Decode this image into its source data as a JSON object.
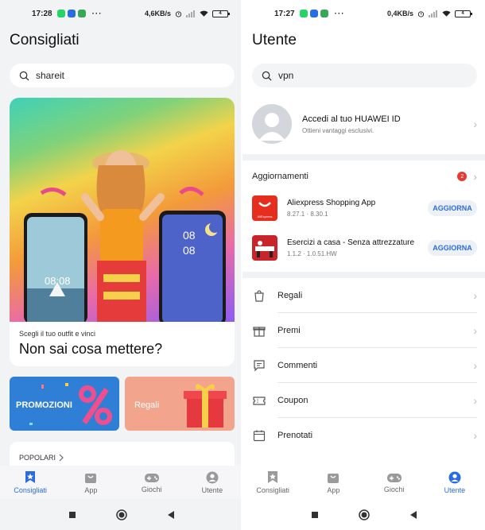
{
  "left": {
    "status": {
      "time": "17:28",
      "speed": "4,6KB/s",
      "battery": "4"
    },
    "title": "Consigliati",
    "search": {
      "value": "shareit"
    },
    "banner": {
      "subtitle": "Scegli il tuo outfit e vinci",
      "title": "Non sai cosa mettere?",
      "phone_time": "08:08",
      "phone2_time_top": "08",
      "phone2_time_bottom": "08"
    },
    "tiles": {
      "promo": "PROMOZIONI",
      "gifts": "Regali"
    },
    "popular": "POPOLARI",
    "nav": [
      {
        "label": "Consigliati",
        "icon": "star-bookmark-icon",
        "active": true
      },
      {
        "label": "App",
        "icon": "bag-icon",
        "active": false
      },
      {
        "label": "Giochi",
        "icon": "gamepad-icon",
        "active": false
      },
      {
        "label": "Utente",
        "icon": "user-icon",
        "active": false
      }
    ]
  },
  "right": {
    "status": {
      "time": "17:27",
      "speed": "0,4KB/s",
      "battery": "4"
    },
    "title": "Utente",
    "search": {
      "value": "vpn"
    },
    "profile": {
      "name": "Accedi al tuo HUAWEI ID",
      "subtitle": "Ottieni vantaggi esclusivi."
    },
    "updates": {
      "label": "Aggiornamenti",
      "count": "2"
    },
    "apps": [
      {
        "name": "Aliexpress Shopping App",
        "version": "8.27.1 · 8.30.1",
        "button": "AGGIORNA",
        "icon_text": "AliExpress"
      },
      {
        "name": "Esercizi a casa - Senza attrezzature",
        "version": "1.1.2 · 1.0.51.HW",
        "button": "AGGIORNA"
      }
    ],
    "menu": [
      {
        "label": "Regali",
        "icon": "gift-bag-icon"
      },
      {
        "label": "Premi",
        "icon": "gift-box-icon"
      },
      {
        "label": "Commenti",
        "icon": "comment-icon"
      },
      {
        "label": "Coupon",
        "icon": "coupon-icon"
      },
      {
        "label": "Prenotati",
        "icon": "calendar-icon"
      }
    ],
    "nav": [
      {
        "label": "Consigliati",
        "icon": "star-bookmark-icon",
        "active": false
      },
      {
        "label": "App",
        "icon": "bag-icon",
        "active": false
      },
      {
        "label": "Giochi",
        "icon": "gamepad-icon",
        "active": false
      },
      {
        "label": "Utente",
        "icon": "user-icon",
        "active": true
      }
    ]
  },
  "colors": {
    "accent": "#2a6de0",
    "badge": "#e53935",
    "promo": "#2f7fd6",
    "gifts": "#f3a48c"
  }
}
